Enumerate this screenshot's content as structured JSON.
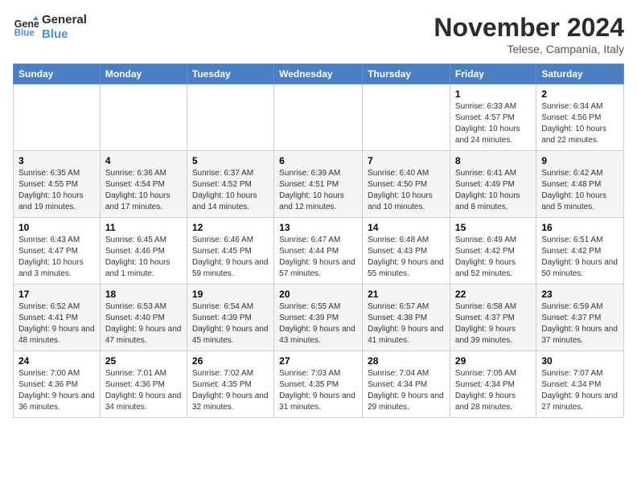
{
  "header": {
    "logo_line1": "General",
    "logo_line2": "Blue",
    "month": "November 2024",
    "location": "Telese, Campania, Italy"
  },
  "days_of_week": [
    "Sunday",
    "Monday",
    "Tuesday",
    "Wednesday",
    "Thursday",
    "Friday",
    "Saturday"
  ],
  "weeks": [
    [
      {
        "num": "",
        "detail": ""
      },
      {
        "num": "",
        "detail": ""
      },
      {
        "num": "",
        "detail": ""
      },
      {
        "num": "",
        "detail": ""
      },
      {
        "num": "",
        "detail": ""
      },
      {
        "num": "1",
        "detail": "Sunrise: 6:33 AM\nSunset: 4:57 PM\nDaylight: 10 hours and 24 minutes."
      },
      {
        "num": "2",
        "detail": "Sunrise: 6:34 AM\nSunset: 4:56 PM\nDaylight: 10 hours and 22 minutes."
      }
    ],
    [
      {
        "num": "3",
        "detail": "Sunrise: 6:35 AM\nSunset: 4:55 PM\nDaylight: 10 hours and 19 minutes."
      },
      {
        "num": "4",
        "detail": "Sunrise: 6:36 AM\nSunset: 4:54 PM\nDaylight: 10 hours and 17 minutes."
      },
      {
        "num": "5",
        "detail": "Sunrise: 6:37 AM\nSunset: 4:52 PM\nDaylight: 10 hours and 14 minutes."
      },
      {
        "num": "6",
        "detail": "Sunrise: 6:39 AM\nSunset: 4:51 PM\nDaylight: 10 hours and 12 minutes."
      },
      {
        "num": "7",
        "detail": "Sunrise: 6:40 AM\nSunset: 4:50 PM\nDaylight: 10 hours and 10 minutes."
      },
      {
        "num": "8",
        "detail": "Sunrise: 6:41 AM\nSunset: 4:49 PM\nDaylight: 10 hours and 8 minutes."
      },
      {
        "num": "9",
        "detail": "Sunrise: 6:42 AM\nSunset: 4:48 PM\nDaylight: 10 hours and 5 minutes."
      }
    ],
    [
      {
        "num": "10",
        "detail": "Sunrise: 6:43 AM\nSunset: 4:47 PM\nDaylight: 10 hours and 3 minutes."
      },
      {
        "num": "11",
        "detail": "Sunrise: 6:45 AM\nSunset: 4:46 PM\nDaylight: 10 hours and 1 minute."
      },
      {
        "num": "12",
        "detail": "Sunrise: 6:46 AM\nSunset: 4:45 PM\nDaylight: 9 hours and 59 minutes."
      },
      {
        "num": "13",
        "detail": "Sunrise: 6:47 AM\nSunset: 4:44 PM\nDaylight: 9 hours and 57 minutes."
      },
      {
        "num": "14",
        "detail": "Sunrise: 6:48 AM\nSunset: 4:43 PM\nDaylight: 9 hours and 55 minutes."
      },
      {
        "num": "15",
        "detail": "Sunrise: 6:49 AM\nSunset: 4:42 PM\nDaylight: 9 hours and 52 minutes."
      },
      {
        "num": "16",
        "detail": "Sunrise: 6:51 AM\nSunset: 4:42 PM\nDaylight: 9 hours and 50 minutes."
      }
    ],
    [
      {
        "num": "17",
        "detail": "Sunrise: 6:52 AM\nSunset: 4:41 PM\nDaylight: 9 hours and 48 minutes."
      },
      {
        "num": "18",
        "detail": "Sunrise: 6:53 AM\nSunset: 4:40 PM\nDaylight: 9 hours and 47 minutes."
      },
      {
        "num": "19",
        "detail": "Sunrise: 6:54 AM\nSunset: 4:39 PM\nDaylight: 9 hours and 45 minutes."
      },
      {
        "num": "20",
        "detail": "Sunrise: 6:55 AM\nSunset: 4:39 PM\nDaylight: 9 hours and 43 minutes."
      },
      {
        "num": "21",
        "detail": "Sunrise: 6:57 AM\nSunset: 4:38 PM\nDaylight: 9 hours and 41 minutes."
      },
      {
        "num": "22",
        "detail": "Sunrise: 6:58 AM\nSunset: 4:37 PM\nDaylight: 9 hours and 39 minutes."
      },
      {
        "num": "23",
        "detail": "Sunrise: 6:59 AM\nSunset: 4:37 PM\nDaylight: 9 hours and 37 minutes."
      }
    ],
    [
      {
        "num": "24",
        "detail": "Sunrise: 7:00 AM\nSunset: 4:36 PM\nDaylight: 9 hours and 36 minutes."
      },
      {
        "num": "25",
        "detail": "Sunrise: 7:01 AM\nSunset: 4:36 PM\nDaylight: 9 hours and 34 minutes."
      },
      {
        "num": "26",
        "detail": "Sunrise: 7:02 AM\nSunset: 4:35 PM\nDaylight: 9 hours and 32 minutes."
      },
      {
        "num": "27",
        "detail": "Sunrise: 7:03 AM\nSunset: 4:35 PM\nDaylight: 9 hours and 31 minutes."
      },
      {
        "num": "28",
        "detail": "Sunrise: 7:04 AM\nSunset: 4:34 PM\nDaylight: 9 hours and 29 minutes."
      },
      {
        "num": "29",
        "detail": "Sunrise: 7:05 AM\nSunset: 4:34 PM\nDaylight: 9 hours and 28 minutes."
      },
      {
        "num": "30",
        "detail": "Sunrise: 7:07 AM\nSunset: 4:34 PM\nDaylight: 9 hours and 27 minutes."
      }
    ]
  ]
}
